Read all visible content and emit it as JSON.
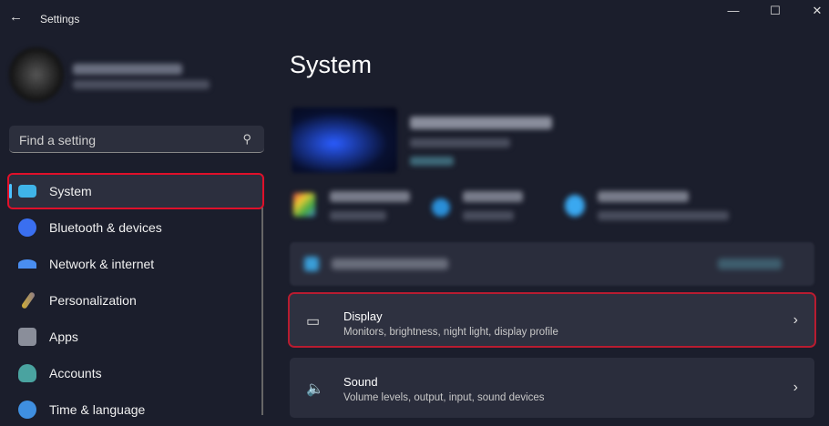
{
  "window": {
    "title": "Settings",
    "back_icon": "←",
    "minimize": "—",
    "maximize": "☐",
    "close": "✕"
  },
  "search": {
    "placeholder": "Find a setting",
    "icon": "⚲"
  },
  "sidebar": {
    "items": [
      {
        "label": "System",
        "color": "#3fb4e8"
      },
      {
        "label": "Bluetooth & devices",
        "color": "#3a6ff0"
      },
      {
        "label": "Network & internet",
        "color": "#4a8ef0"
      },
      {
        "label": "Personalization",
        "color": "#c9a86a"
      },
      {
        "label": "Apps",
        "color": "#8a8e9a"
      },
      {
        "label": "Accounts",
        "color": "#4aa3a0"
      },
      {
        "label": "Time & language",
        "color": "#3f8fe0"
      }
    ]
  },
  "main": {
    "title": "System",
    "cards": [
      {
        "title": "Display",
        "subtitle": "Monitors, brightness, night light, display profile",
        "icon": "▭",
        "chevron": "›"
      },
      {
        "title": "Sound",
        "subtitle": "Volume levels, output, input, sound devices",
        "icon": "🔈",
        "chevron": "›"
      }
    ]
  }
}
